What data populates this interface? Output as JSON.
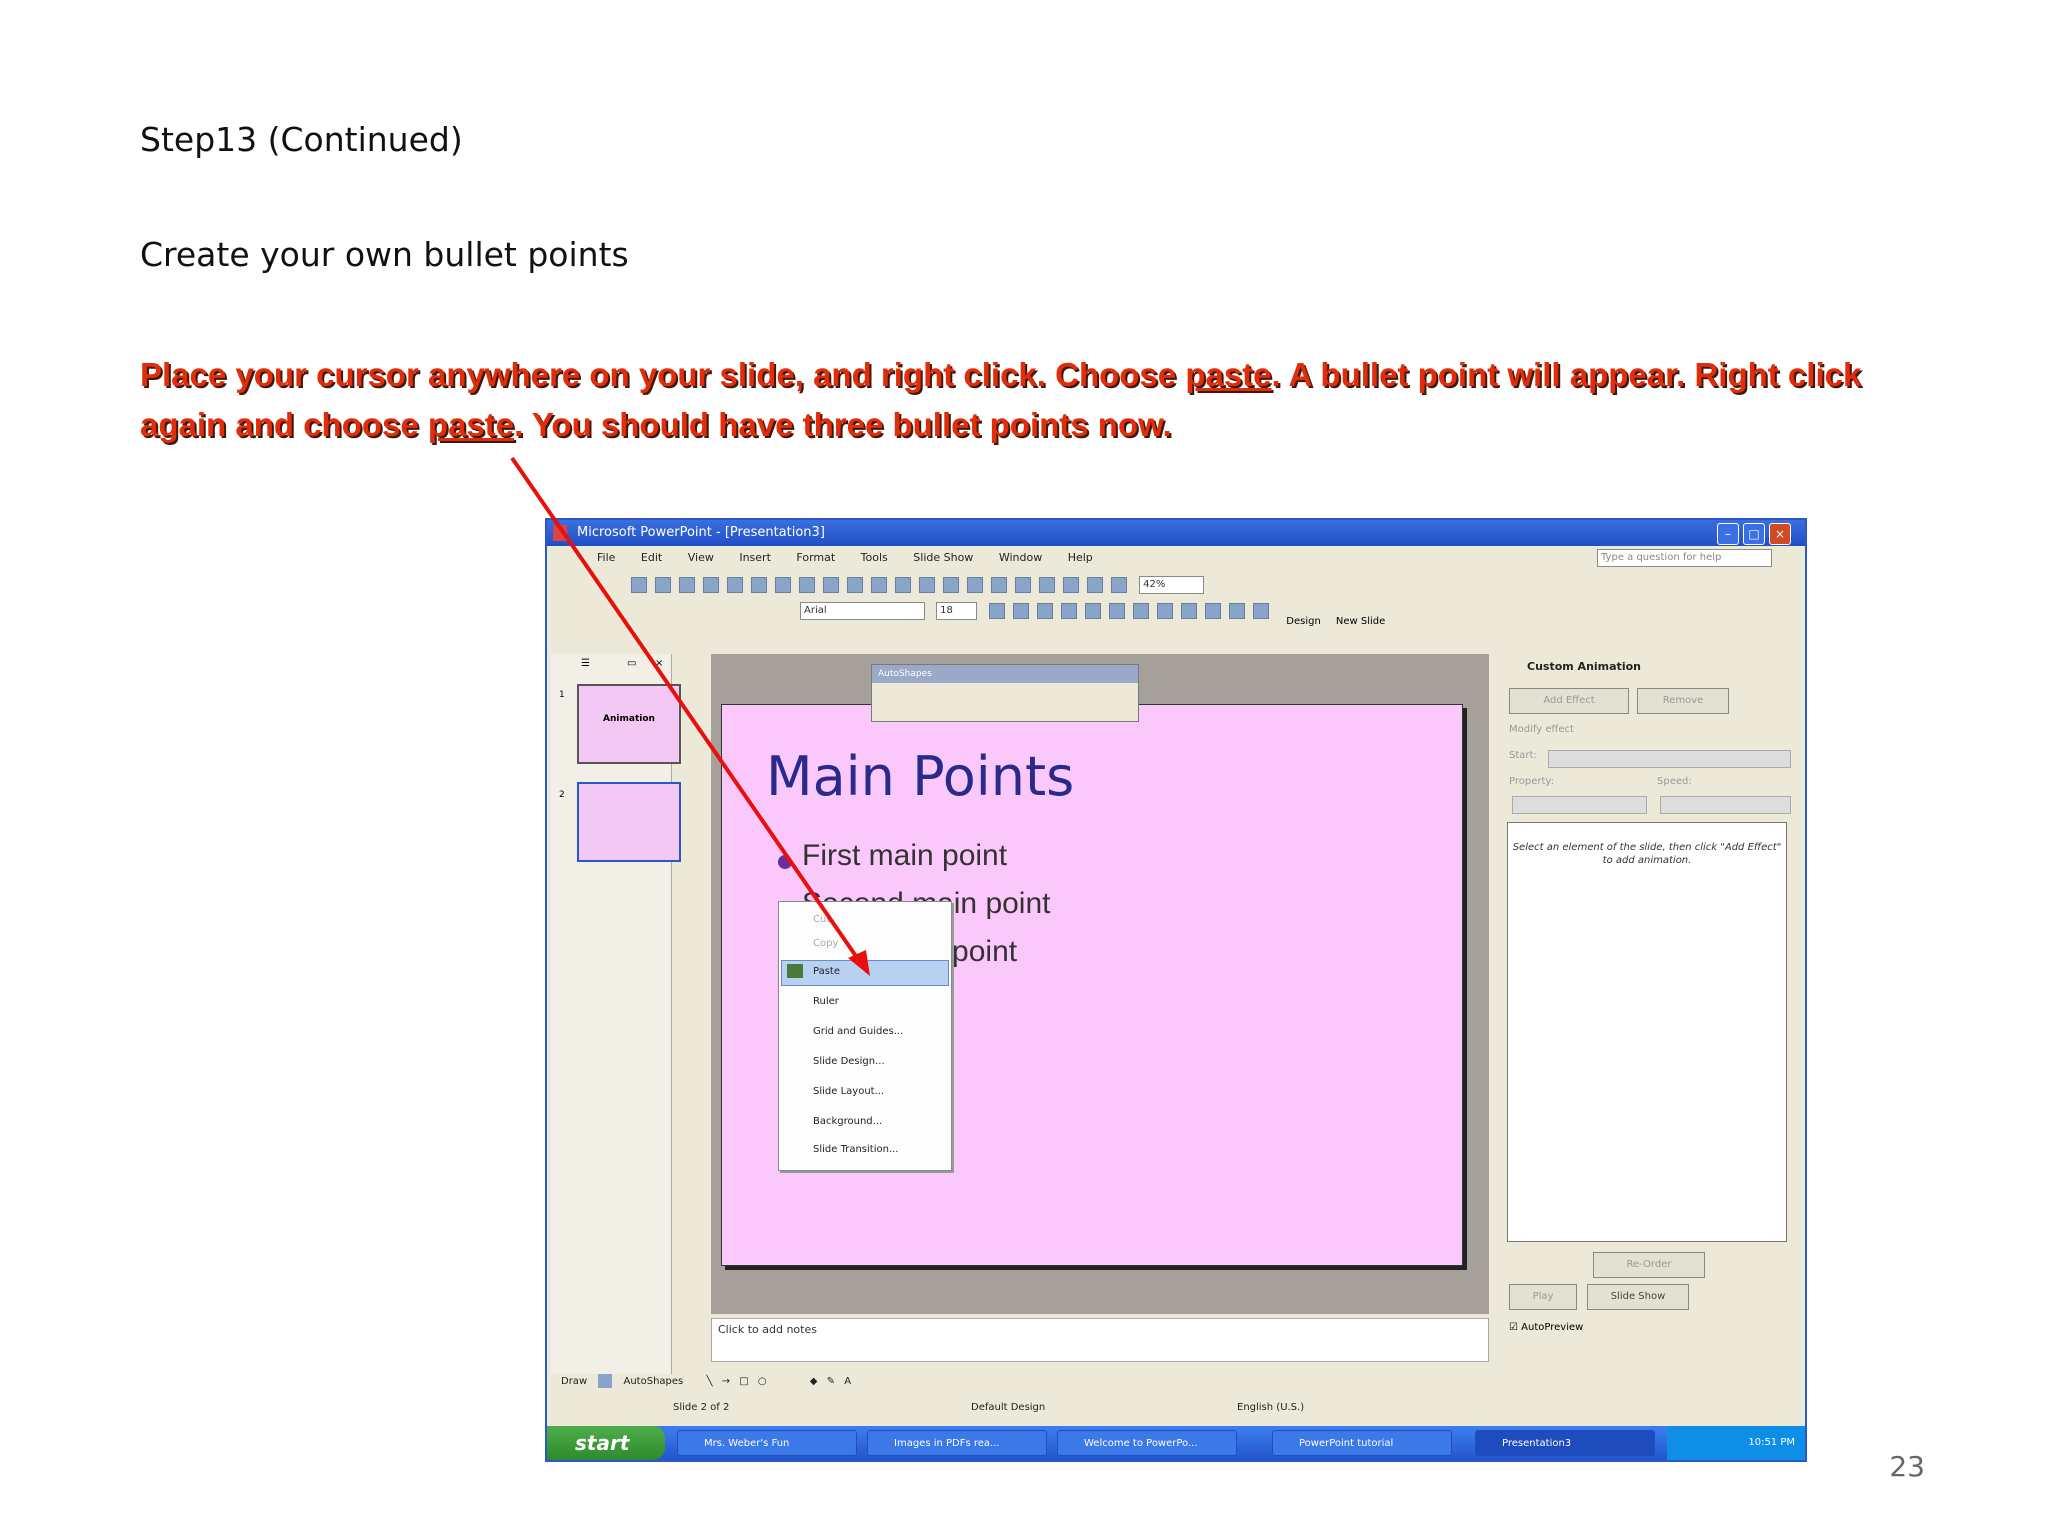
{
  "heading": "Step13 (Continued)",
  "subheading": "Create your own bullet points",
  "instruction": {
    "part1": "Place your cursor anywhere on your slide, and right click. Choose ",
    "link1": "paste",
    "part2": ". A bullet point will appear. Right click",
    "part3": "again and choose ",
    "link2": "paste",
    "part4": ". You should have three bullet points now."
  },
  "page_number": "23",
  "colors": {
    "instruction_text": "#e32d0a",
    "arrow": "#e8100c",
    "slide_bg": "#fbc8fb",
    "title_text": "#2a2a8a"
  },
  "screenshot": {
    "window_title": "Microsoft PowerPoint - [Presentation3]",
    "menus": [
      "File",
      "Edit",
      "View",
      "Insert",
      "Format",
      "Tools",
      "Slide Show",
      "Window",
      "Help"
    ],
    "help_box": "Type a question for help",
    "zoom": "42%",
    "font_name": "Arial",
    "font_size": "18",
    "design_btn": "Design",
    "new_slide_btn": "New Slide",
    "thumb1_label": "Animation",
    "floater_title": "AutoShapes",
    "slide_title": "Main Points",
    "bullets": [
      "First main point",
      "Second main point",
      "Third main point"
    ],
    "context_menu": [
      "Cut",
      "Copy",
      "Paste",
      "Ruler",
      "Grid and Guides...",
      "Slide Design...",
      "Slide Layout...",
      "Background...",
      "Slide Transition..."
    ],
    "taskpane_title": "Custom Animation",
    "add_effect": "Add Effect",
    "remove": "Remove",
    "modify_effect": "Modify effect",
    "start": "Start:",
    "property": "Property:",
    "speed": "Speed:",
    "taskpane_hint": "Select an element of the slide, then click \"Add Effect\" to add animation.",
    "reorder": "Re-Order",
    "play": "Play",
    "slideshow": "Slide Show",
    "autopreview": "AutoPreview",
    "notes": "Click to add notes",
    "draw": "Draw",
    "autoshapes": "AutoShapes",
    "status_slide": "Slide 2 of 2",
    "status_design": "Default Design",
    "status_lang": "English (U.S.)",
    "start_button": "start",
    "taskbar_apps": [
      "Mrs. Weber's Fun",
      "Images in PDFs rea...",
      "Welcome to PowerPo...",
      "PowerPoint tutorial",
      "Presentation3"
    ],
    "clock": "10:51 PM"
  }
}
